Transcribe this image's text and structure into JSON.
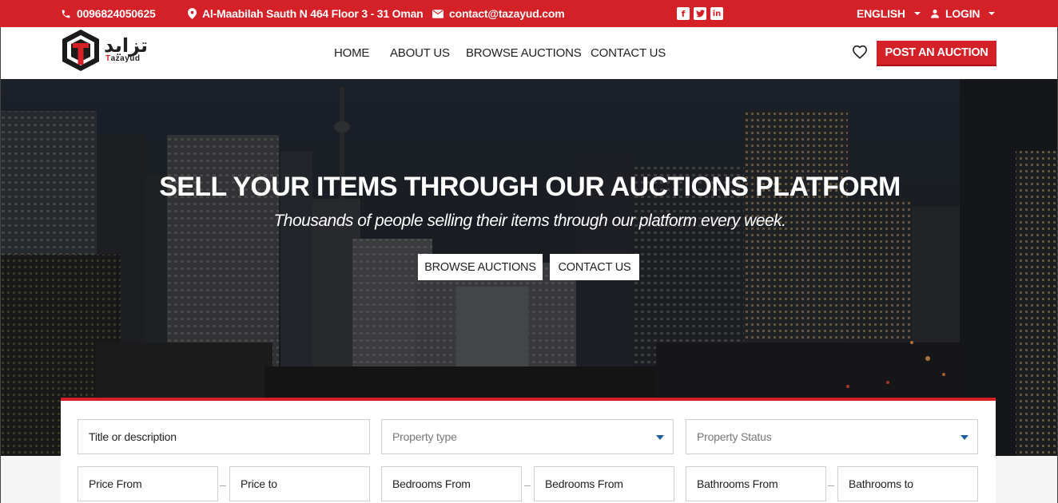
{
  "topbar": {
    "phone": "0096824050625",
    "address": "Al-Maabilah Sauth N 464 Floor 3 - 31 Oman",
    "email": "contact@tazayud.com",
    "social": [
      "facebook-icon",
      "twitter-icon",
      "linkedin-icon"
    ],
    "language": "ENGLISH",
    "login": "LOGIN",
    "color": "#d42027"
  },
  "logo": {
    "arabic": "تزايد",
    "english_first": "T",
    "english_rest": "azayud"
  },
  "nav": {
    "items": [
      "HOME",
      "ABOUT US",
      "BROWSE AUCTIONS",
      "CONTACT US"
    ],
    "wishlist_icon": "heart-icon",
    "post_label": "POST AN AUCTION"
  },
  "hero": {
    "title": "SELL YOUR ITEMS THROUGH OUR AUCTIONS PLATFORM",
    "subtitle": "Thousands of people selling their items through our platform every week.",
    "buttons": [
      "BROWSE AUCTIONS",
      "CONTACT US"
    ]
  },
  "search": {
    "title_placeholder": "Title or description",
    "property_type": "Property type",
    "property_status": "Property Status",
    "price_from": "Price From",
    "price_to": "Price to",
    "bedrooms_from": "Bedrooms From",
    "bedrooms_to": "Bedrooms From",
    "bathrooms_from": "Bathrooms From",
    "bathrooms_to": "Bathrooms to"
  }
}
